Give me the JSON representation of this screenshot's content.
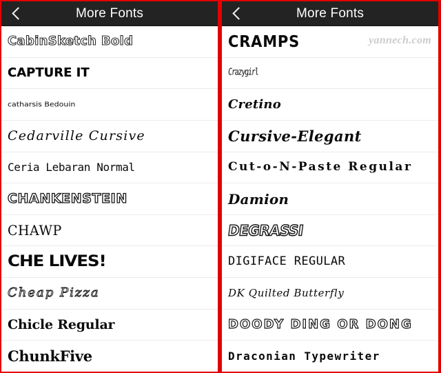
{
  "app": {
    "screen_title": "More Fonts",
    "back_icon": "chevron-left-icon",
    "header_bg": "#232323",
    "header_text_color": "#ffffff",
    "frame_border_color": "#e40000",
    "row_divider_color": "#ececec"
  },
  "watermark": {
    "text": "yannech.com",
    "color": "#cccccc"
  },
  "panels": [
    {
      "id": "left",
      "title": "More Fonts",
      "fonts": [
        {
          "label": "CabinSketch Bold"
        },
        {
          "label": "CAPTURE IT"
        },
        {
          "label": "catharsis Bedouin"
        },
        {
          "label": "Cedarville Cursive"
        },
        {
          "label": "Ceria Lebaran Normal"
        },
        {
          "label": "CHANKENSTEIN"
        },
        {
          "label": "CHAWP"
        },
        {
          "label": "CHE LIVES!"
        },
        {
          "label": "Cheap   Pizza"
        },
        {
          "label": "Chicle Regular"
        },
        {
          "label": "ChunkFive"
        }
      ]
    },
    {
      "id": "right",
      "title": "More Fonts",
      "fonts": [
        {
          "label": "CRAMPS"
        },
        {
          "label": "Crazygirl"
        },
        {
          "label": "Cretino"
        },
        {
          "label": "Cursive-Elegant"
        },
        {
          "label": "Cut-o-N-Paste Regular"
        },
        {
          "label": "Damion"
        },
        {
          "label": "DEGRASSI"
        },
        {
          "label": "DIGIFACE REGULAR"
        },
        {
          "label": "DK Quilted Butterfly"
        },
        {
          "label": "DOODY DING OR DONG"
        },
        {
          "label": "Draconian Typewriter"
        }
      ]
    }
  ]
}
